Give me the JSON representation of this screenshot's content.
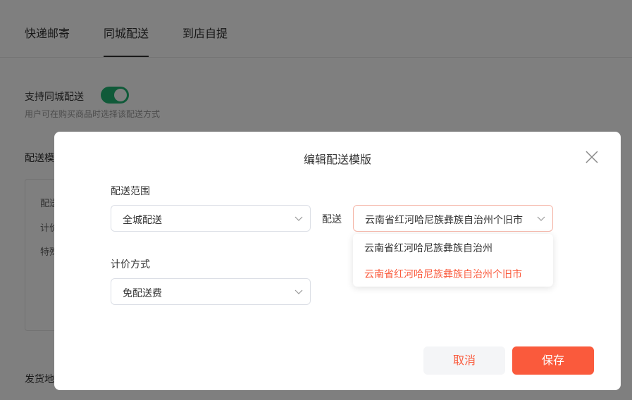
{
  "tabs": [
    {
      "label": "快递邮寄"
    },
    {
      "label": "同城配送"
    },
    {
      "label": "到店自提"
    }
  ],
  "background": {
    "support_label": "支持同城配送",
    "support_desc": "用户可在购买商品时选择该配送方式",
    "template_label": "配送模",
    "box_lines": [
      "配送",
      "计价",
      "特殊"
    ],
    "ship_label": "发货地"
  },
  "modal": {
    "title": "编辑配送模版",
    "range_label": "配送范围",
    "range_value": "全城配送",
    "delivery_label": "配送",
    "delivery_value": "云南省红河哈尼族彝族自治州个旧市",
    "dropdown_options": [
      "云南省红河哈尼族彝族自治州",
      "云南省红河哈尼族彝族自治州个旧市"
    ],
    "pricing_label": "计价方式",
    "pricing_value": "免配送费",
    "cancel_label": "取消",
    "save_label": "保存"
  },
  "colors": {
    "accent": "#fa5a3c",
    "toggle_on": "#21b573"
  }
}
